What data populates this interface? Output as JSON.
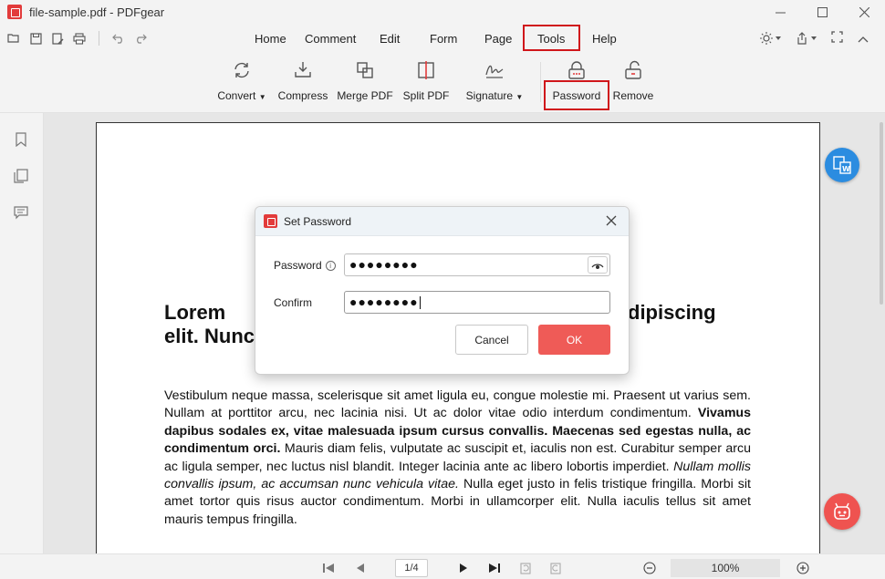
{
  "window": {
    "title": "file-sample.pdf - PDFgear"
  },
  "menu": {
    "items": [
      "Home",
      "Comment",
      "Edit",
      "Form",
      "Page",
      "Tools",
      "Help"
    ],
    "active": "Tools"
  },
  "ribbon": {
    "buttons": [
      {
        "label": "Convert",
        "icon": "convert-icon",
        "dropdown": true
      },
      {
        "label": "Compress",
        "icon": "compress-icon",
        "dropdown": false
      },
      {
        "label": "Merge PDF",
        "icon": "merge-icon",
        "dropdown": false
      },
      {
        "label": "Split PDF",
        "icon": "split-icon",
        "dropdown": false
      },
      {
        "label": "Signature",
        "icon": "signature-icon",
        "dropdown": true
      },
      {
        "label": "Password",
        "icon": "lock-icon",
        "dropdown": false
      },
      {
        "label": "Remove",
        "icon": "unlock-icon",
        "dropdown": false
      }
    ],
    "highlighted": "Password"
  },
  "document": {
    "heading_a": "Lorem",
    "heading_b": "dipiscing",
    "heading_c": "elit. Nunc",
    "paragraph": [
      {
        "text": "Vestibulum neque massa, scelerisque sit amet ligula eu, congue molestie mi. Praesent ut varius sem. Nullam at porttitor arcu, nec lacinia nisi. Ut ac dolor vitae odio interdum condimentum. ",
        "style": "normal"
      },
      {
        "text": "Vivamus dapibus sodales ex, vitae malesuada ipsum cursus convallis. Maecenas sed egestas nulla, ac condimentum orci.",
        "style": "bold"
      },
      {
        "text": " Mauris diam felis, vulputate ac suscipit et, iaculis non est. Curabitur semper arcu ac ligula semper, nec luctus nisl blandit. Integer lacinia ante ac libero lobortis imperdiet. ",
        "style": "normal"
      },
      {
        "text": "Nullam mollis convallis ipsum, ac accumsan nunc vehicula vitae.",
        "style": "italic"
      },
      {
        "text": " Nulla eget justo in felis tristique fringilla. Morbi sit amet tortor quis risus auctor condimentum. Morbi in ullamcorper elit. Nulla iaculis tellus sit amet mauris tempus fringilla.",
        "style": "normal"
      }
    ]
  },
  "dialog": {
    "title": "Set Password",
    "password_label": "Password",
    "password_value": "●●●●●●●●",
    "confirm_label": "Confirm",
    "confirm_value": "●●●●●●●●",
    "cancel_label": "Cancel",
    "ok_label": "OK"
  },
  "statusbar": {
    "page_indicator": "1/4",
    "zoom": "100%"
  },
  "colors": {
    "accent": "#ef5b57",
    "highlight_box": "#d0161b",
    "convert_fab": "#2b8ce0"
  }
}
